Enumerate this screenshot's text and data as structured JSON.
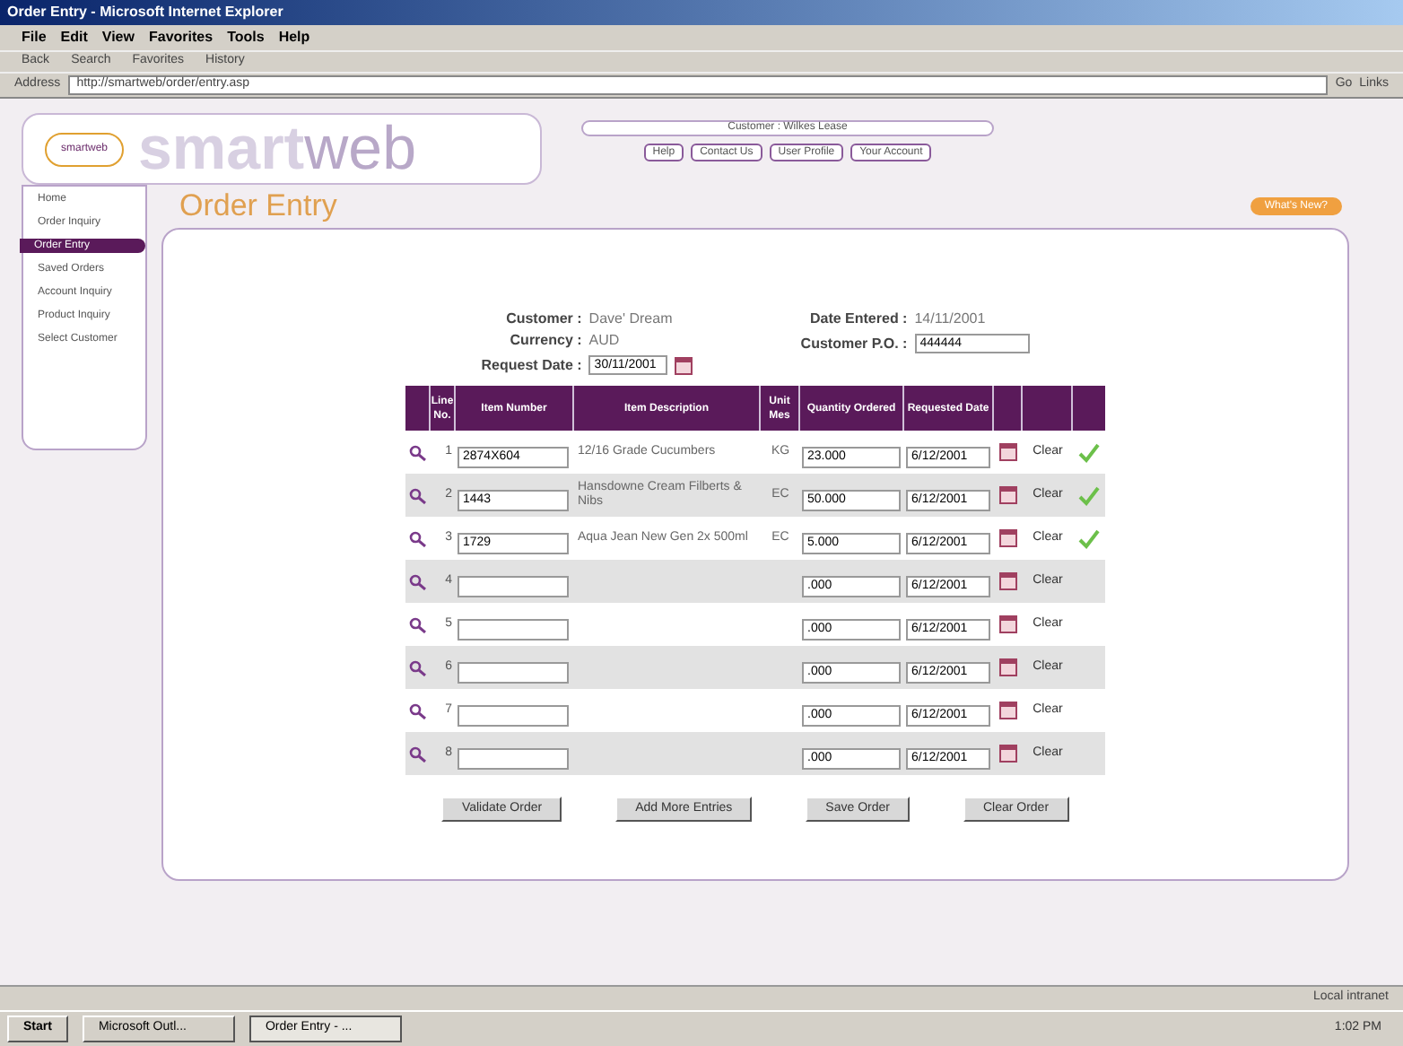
{
  "window": {
    "title": "Order Entry - Microsoft Internet Explorer"
  },
  "menu": [
    "File",
    "Edit",
    "View",
    "Favorites",
    "Tools",
    "Help"
  ],
  "toolbar": [
    "Back",
    "Search",
    "Favorites",
    "History"
  ],
  "address": {
    "label": "Address",
    "value": "http://smartweb/order/entry.asp",
    "go": "Go",
    "links": "Links"
  },
  "header": {
    "logo_small": "smartweb",
    "logo_a": "smart",
    "logo_b": "web",
    "user": "Customer : Wilkes Lease",
    "buttons": [
      "Help",
      "Contact Us",
      "User Profile",
      "Your Account"
    ],
    "whats_new": "What's New?"
  },
  "sidebar": {
    "items": [
      {
        "label": "Home",
        "selected": false
      },
      {
        "label": "Order Inquiry",
        "selected": false
      },
      {
        "label": "Order Entry",
        "selected": true
      },
      {
        "label": "Saved Orders",
        "selected": false
      },
      {
        "label": "Account Inquiry",
        "selected": false
      },
      {
        "label": "Product Inquiry",
        "selected": false
      },
      {
        "label": "Select Customer",
        "selected": false
      }
    ]
  },
  "page_title": "Order Entry",
  "order": {
    "customer_label": "Customer :",
    "customer": "Dave' Dream",
    "currency_label": "Currency :",
    "currency": "AUD",
    "request_label": "Request Date :",
    "request_date": "30/11/2001",
    "entered_label": "Date Entered :",
    "entered": "14/11/2001",
    "po_label": "Customer P.O. :",
    "po": "444444"
  },
  "table": {
    "columns": [
      "Line No.",
      "Item Number",
      "Item Description",
      "Unit Mes",
      "Quantity Ordered",
      "Requested Date"
    ],
    "rows": [
      {
        "line": "1",
        "item": "2874X604",
        "description": "12/16 Grade Cucumbers",
        "unit": "KG",
        "qty": "23.000",
        "date": "6/12/2001",
        "clear": "Clear",
        "validated": true
      },
      {
        "line": "2",
        "item": "1443",
        "description": "Hansdowne Cream Filberts & Nibs",
        "unit": "EC",
        "qty": "50.000",
        "date": "6/12/2001",
        "clear": "Clear",
        "validated": true
      },
      {
        "line": "3",
        "item": "1729",
        "description": "Aqua Jean New Gen 2x 500ml",
        "unit": "EC",
        "qty": "5.000",
        "date": "6/12/2001",
        "clear": "Clear",
        "validated": true
      },
      {
        "line": "4",
        "item": "",
        "description": "",
        "unit": "",
        "qty": ".000",
        "date": "6/12/2001",
        "clear": "Clear",
        "validated": false
      },
      {
        "line": "5",
        "item": "",
        "description": "",
        "unit": "",
        "qty": ".000",
        "date": "6/12/2001",
        "clear": "Clear",
        "validated": false
      },
      {
        "line": "6",
        "item": "",
        "description": "",
        "unit": "",
        "qty": ".000",
        "date": "6/12/2001",
        "clear": "Clear",
        "validated": false
      },
      {
        "line": "7",
        "item": "",
        "description": "",
        "unit": "",
        "qty": ".000",
        "date": "6/12/2001",
        "clear": "Clear",
        "validated": false
      },
      {
        "line": "8",
        "item": "",
        "description": "",
        "unit": "",
        "qty": ".000",
        "date": "6/12/2001",
        "clear": "Clear",
        "validated": false
      }
    ]
  },
  "actions": [
    "Validate Order",
    "Add More Entries",
    "Save Order",
    "Clear Order"
  ],
  "status_bar": {
    "zone": "Local intranet"
  },
  "taskbar": {
    "start": "Start",
    "tasks": [
      {
        "label": "Microsoft Outl...",
        "selected": false
      },
      {
        "label": "Order Entry - ...",
        "selected": true
      }
    ],
    "time": "1:02 PM"
  }
}
